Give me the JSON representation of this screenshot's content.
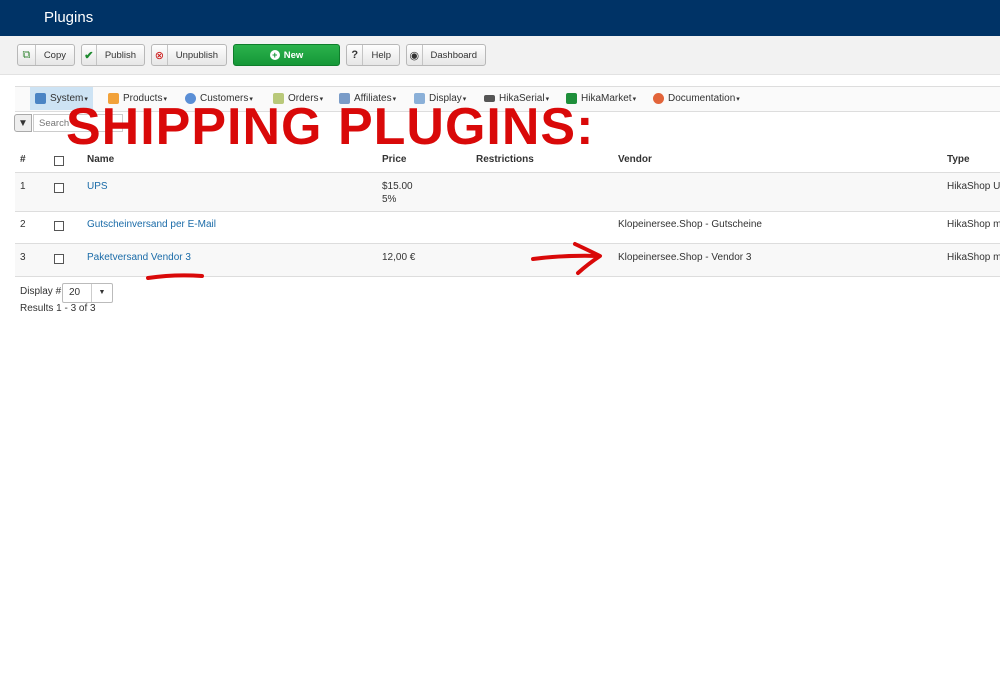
{
  "header": {
    "title": "Plugins"
  },
  "toolbar": {
    "copy": "Copy",
    "publish": "Publish",
    "unpublish": "Unpublish",
    "new": "New",
    "help": "Help",
    "dashboard": "Dashboard"
  },
  "menu": {
    "items": [
      {
        "label": "System"
      },
      {
        "label": "Products"
      },
      {
        "label": "Customers"
      },
      {
        "label": "Orders"
      },
      {
        "label": "Affiliates"
      },
      {
        "label": "Display"
      },
      {
        "label": "HikaSerial"
      },
      {
        "label": "HikaMarket"
      },
      {
        "label": "Documentation"
      }
    ]
  },
  "search": {
    "placeholder": "Search"
  },
  "annotation": {
    "text": "SHIPPING PLUGINS:",
    "color": "#d90909"
  },
  "table": {
    "columns": [
      "#",
      "",
      "Name",
      "Price",
      "Restrictions",
      "Vendor",
      "Type"
    ],
    "rows": [
      {
        "num": "1",
        "name": "UPS",
        "price": "$15.00",
        "price2": "5%",
        "restrictions": "",
        "vendor": "",
        "type": "HikaShop U"
      },
      {
        "num": "2",
        "name": "Gutscheinversand per E-Mail",
        "price": "",
        "price2": "",
        "restrictions": "",
        "vendor": "Klopeinersee.Shop - Gutscheine",
        "type": "HikaShop m"
      },
      {
        "num": "3",
        "name": "Paketversand Vendor 3",
        "price": "12,00 €",
        "price2": "",
        "restrictions": "",
        "vendor": "Klopeinersee.Shop - Vendor 3",
        "type": "HikaShop m"
      }
    ]
  },
  "pagination": {
    "display_label": "Display #",
    "display_value": "20",
    "results": "Results 1 - 3 of 3"
  },
  "colors": {
    "header_bg": "#003366",
    "link": "#1a6ba8",
    "new_button": "#1da640",
    "annotation": "#d90909"
  }
}
